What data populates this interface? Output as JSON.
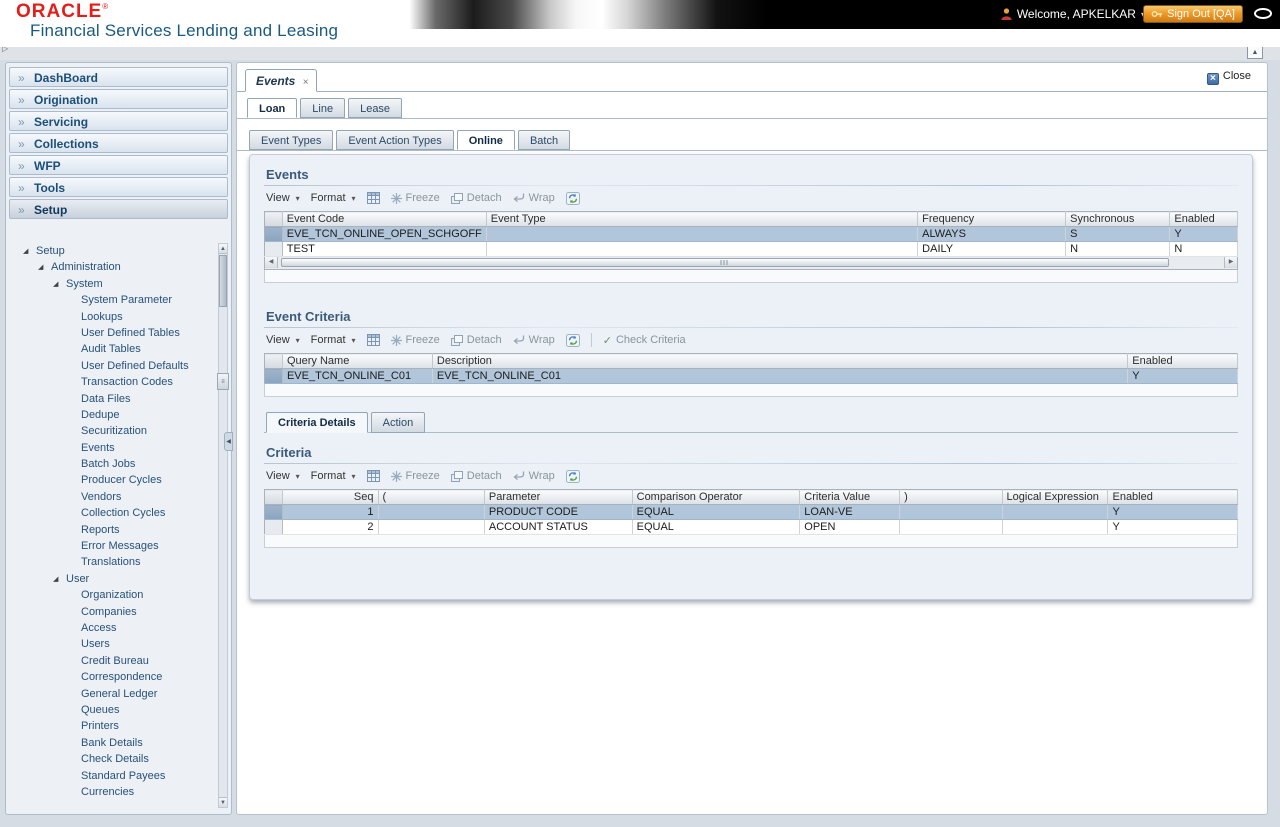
{
  "header": {
    "logo": "ORACLE",
    "logo_mark": "®",
    "tagline": "Financial Services Lending and Leasing",
    "welcome": "Welcome, APKELKAR",
    "sign_out": "Sign Out [QA]"
  },
  "sidebar": {
    "menu_items": [
      {
        "label": "DashBoard",
        "selected": false
      },
      {
        "label": "Origination",
        "selected": false
      },
      {
        "label": "Servicing",
        "selected": false
      },
      {
        "label": "Collections",
        "selected": false
      },
      {
        "label": "WFP",
        "selected": false
      },
      {
        "label": "Tools",
        "selected": false
      },
      {
        "label": "Setup",
        "selected": true
      }
    ],
    "tree": [
      {
        "label": "Setup",
        "level": 0,
        "expandable": true
      },
      {
        "label": "Administration",
        "level": 1,
        "expandable": true
      },
      {
        "label": "System",
        "level": 2,
        "expandable": true
      },
      {
        "label": "System Parameter",
        "level": 3,
        "expandable": false
      },
      {
        "label": "Lookups",
        "level": 3,
        "expandable": false
      },
      {
        "label": "User Defined Tables",
        "level": 3,
        "expandable": false
      },
      {
        "label": "Audit Tables",
        "level": 3,
        "expandable": false
      },
      {
        "label": "User Defined Defaults",
        "level": 3,
        "expandable": false
      },
      {
        "label": "Transaction Codes",
        "level": 3,
        "expandable": false
      },
      {
        "label": "Data Files",
        "level": 3,
        "expandable": false
      },
      {
        "label": "Dedupe",
        "level": 3,
        "expandable": false
      },
      {
        "label": "Securitization",
        "level": 3,
        "expandable": false
      },
      {
        "label": "Events",
        "level": 3,
        "expandable": false
      },
      {
        "label": "Batch Jobs",
        "level": 3,
        "expandable": false
      },
      {
        "label": "Producer Cycles",
        "level": 3,
        "expandable": false
      },
      {
        "label": "Vendors",
        "level": 3,
        "expandable": false
      },
      {
        "label": "Collection Cycles",
        "level": 3,
        "expandable": false
      },
      {
        "label": "Reports",
        "level": 3,
        "expandable": false
      },
      {
        "label": "Error Messages",
        "level": 3,
        "expandable": false
      },
      {
        "label": "Translations",
        "level": 3,
        "expandable": false
      },
      {
        "label": "User",
        "level": 2,
        "expandable": true
      },
      {
        "label": "Organization",
        "level": 3,
        "expandable": false
      },
      {
        "label": "Companies",
        "level": 3,
        "expandable": false
      },
      {
        "label": "Access",
        "level": 3,
        "expandable": false
      },
      {
        "label": "Users",
        "level": 3,
        "expandable": false
      },
      {
        "label": "Credit Bureau",
        "level": 3,
        "expandable": false
      },
      {
        "label": "Correspondence",
        "level": 3,
        "expandable": false
      },
      {
        "label": "General Ledger",
        "level": 3,
        "expandable": false
      },
      {
        "label": "Queues",
        "level": 3,
        "expandable": false
      },
      {
        "label": "Printers",
        "level": 3,
        "expandable": false
      },
      {
        "label": "Bank Details",
        "level": 3,
        "expandable": false
      },
      {
        "label": "Check Details",
        "level": 3,
        "expandable": false
      },
      {
        "label": "Standard Payees",
        "level": 3,
        "expandable": false
      },
      {
        "label": "Currencies",
        "level": 3,
        "expandable": false
      }
    ]
  },
  "workspace": {
    "document_tab": "Events",
    "close_label": "Close",
    "portfolio_tabs": [
      {
        "label": "Loan",
        "active": true
      },
      {
        "label": "Line",
        "active": false
      },
      {
        "label": "Lease",
        "active": false
      }
    ],
    "setup_tabs": [
      {
        "label": "Event Types",
        "active": false
      },
      {
        "label": "Event Action Types",
        "active": false
      },
      {
        "label": "Online",
        "active": true
      },
      {
        "label": "Batch",
        "active": false
      }
    ],
    "detail_tabs": [
      {
        "label": "Criteria Details",
        "active": true
      },
      {
        "label": "Action",
        "active": false
      }
    ]
  },
  "toolbar_labels": {
    "view": "View",
    "format": "Format",
    "freeze": "Freeze",
    "detach": "Detach",
    "wrap": "Wrap",
    "check_criteria": "Check Criteria"
  },
  "sections": {
    "events": {
      "title": "Events",
      "columns": [
        "Event Code",
        "Event Type",
        "Frequency",
        "Synchronous",
        "Enabled"
      ],
      "rows": [
        {
          "selected": true,
          "cells": [
            "EVE_TCN_ONLINE_OPEN_SCHGOFF",
            "",
            "ALWAYS",
            "S",
            "Y"
          ]
        },
        {
          "selected": false,
          "cells": [
            "TEST",
            "",
            "DAILY",
            "N",
            "N"
          ]
        }
      ]
    },
    "event_criteria": {
      "title": "Event Criteria",
      "columns": [
        "Query Name",
        "Description",
        "Enabled"
      ],
      "rows": [
        {
          "selected": true,
          "cells": [
            "EVE_TCN_ONLINE_C01",
            "EVE_TCN_ONLINE_C01",
            "Y"
          ]
        }
      ]
    },
    "criteria": {
      "title": "Criteria",
      "columns": [
        "Seq",
        "(",
        "Parameter",
        "Comparison Operator",
        "Criteria Value",
        ")",
        "Logical Expression",
        "Enabled"
      ],
      "rows": [
        {
          "selected": true,
          "cells": [
            "1",
            "",
            "PRODUCT CODE",
            "EQUAL",
            "LOAN-VE",
            "",
            "",
            "Y"
          ]
        },
        {
          "selected": false,
          "cells": [
            "2",
            "",
            "ACCOUNT STATUS",
            "EQUAL",
            "OPEN",
            "",
            "",
            "Y"
          ]
        }
      ]
    }
  }
}
